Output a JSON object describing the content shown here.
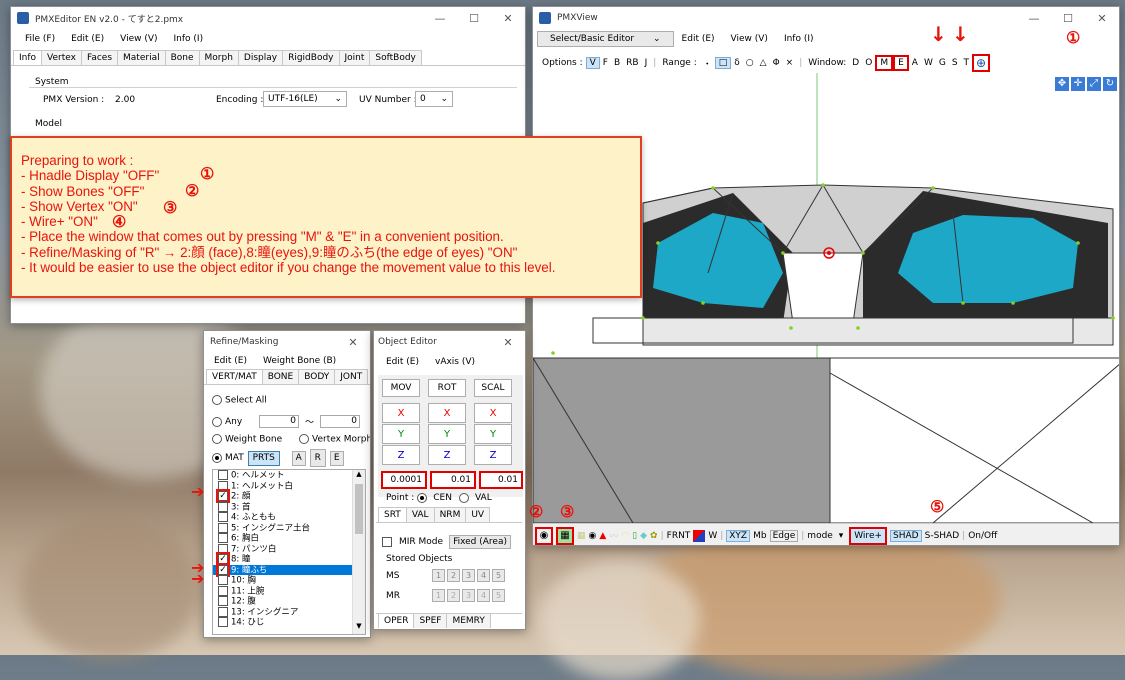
{
  "pmxeditor": {
    "title": "PMXEditor EN v2.0 - てすと2.pmx",
    "menu": [
      "File (F)",
      "Edit (E)",
      "View (V)",
      "Info (I)"
    ],
    "tabs": [
      "Info",
      "Vertex",
      "Faces",
      "Material",
      "Bone",
      "Morph",
      "Display",
      "RigidBody",
      "Joint",
      "SoftBody"
    ],
    "system_label": "System",
    "pmx_version_label": "PMX Version :",
    "pmx_version": "2.00",
    "encoding_label": "Encoding :",
    "encoding": "UTF-16(LE)",
    "uv_label": "UV Number :",
    "uv_number": "0",
    "model_label": "Model"
  },
  "pmxview": {
    "title": "PMXView",
    "menu_select": "Select/Basic Editor",
    "menu": [
      "Edit (E)",
      "View (V)",
      "Info (I)"
    ],
    "options_label": "Options :",
    "options": [
      "V",
      "F",
      "B",
      "RB",
      "J"
    ],
    "range_label": "Range :",
    "range_items": [
      "・",
      "□",
      "δ",
      "○",
      "△",
      "Φ",
      "×"
    ],
    "window_label": "Window:",
    "window_items": [
      "D",
      "O",
      "M",
      "E",
      "A",
      "W",
      "G",
      "S",
      "T"
    ],
    "bottom": {
      "frnt": "FRNT",
      "w": "W",
      "xyz": "XYZ",
      "mb": "Mb",
      "edge": "Edge",
      "mode": "mode",
      "wire": "Wire+",
      "shad": "SHAD",
      "sshad": "S-SHAD",
      "onoff": "On/Off"
    }
  },
  "note": {
    "lines": [
      "Preparing to work :",
      "- Hnadle Display \"OFF\"",
      "- Show Bones \"OFF\"",
      "- Show Vertex \"ON\"",
      "- Wire+ \"ON\"",
      "- Place the window that comes out by pressing \"M\" & \"E\" in a convenient position.",
      "- Refine/Masking of \"R\" → 2:顔 (face),8:瞳(eyes),9:瞳のふち(the edge of eyes) \"ON\"",
      "- It would be easier to use the object editor if you change the movement value to this level."
    ],
    "marks": [
      "①",
      "②",
      "③",
      "④",
      "⑤"
    ]
  },
  "refine": {
    "title": "Refine/Masking",
    "menu": [
      "Edit (E)",
      "Weight Bone (B)"
    ],
    "tabs": [
      "VERT/MAT",
      "BONE",
      "BODY",
      "JONT"
    ],
    "select_all": "Select All",
    "any": "Any",
    "any_from": "0",
    "any_tilde": "〜",
    "any_to": "0",
    "weight_bone": "Weight Bone",
    "vertex_morph": "Vertex Morph",
    "mat": "MAT",
    "prts": "PRTS",
    "a": "A",
    "r": "R",
    "e": "E",
    "items": [
      {
        "label": "0: ヘルメット",
        "checked": false
      },
      {
        "label": "1: ヘルメット白",
        "checked": false
      },
      {
        "label": "2: 顔",
        "checked": true
      },
      {
        "label": "3: 首",
        "checked": false
      },
      {
        "label": "4: ふともも",
        "checked": false
      },
      {
        "label": "5: インシグニア土台",
        "checked": false
      },
      {
        "label": "6: 胸白",
        "checked": false
      },
      {
        "label": "7: パンツ白",
        "checked": false
      },
      {
        "label": "8: 瞳",
        "checked": true
      },
      {
        "label": "9: 瞳ふち",
        "checked": true
      },
      {
        "label": "10: 胸",
        "checked": false
      },
      {
        "label": "11: 上腕",
        "checked": false
      },
      {
        "label": "12: 腹",
        "checked": false
      },
      {
        "label": "13: インシグニア",
        "checked": false
      },
      {
        "label": "14: ひじ",
        "checked": false
      }
    ]
  },
  "objeditor": {
    "title": "Object Editor",
    "menu": [
      "Edit (E)",
      "vAxis (V)"
    ],
    "mov": "MOV",
    "rot": "ROT",
    "scal": "SCAL",
    "x": "X",
    "y": "Y",
    "z": "Z",
    "values": [
      "0.0001",
      "0.01",
      "0.01"
    ],
    "point_label": "Point :",
    "cen": "CEN",
    "val": "VAL",
    "tabs": [
      "SRT",
      "VAL",
      "NRM",
      "UV"
    ],
    "mir": "MIR Mode",
    "fixed": "Fixed (Area)",
    "stored": "Stored Objects",
    "ms": "MS",
    "mr": "MR",
    "slots": [
      "1",
      "2",
      "3",
      "4",
      "5"
    ],
    "bottom_tabs": [
      "OPER",
      "SPEF",
      "MEMRY"
    ]
  },
  "colors": {
    "accent": "#e8140c",
    "selection": "#0078d7",
    "eye": "#1ea8c8"
  }
}
